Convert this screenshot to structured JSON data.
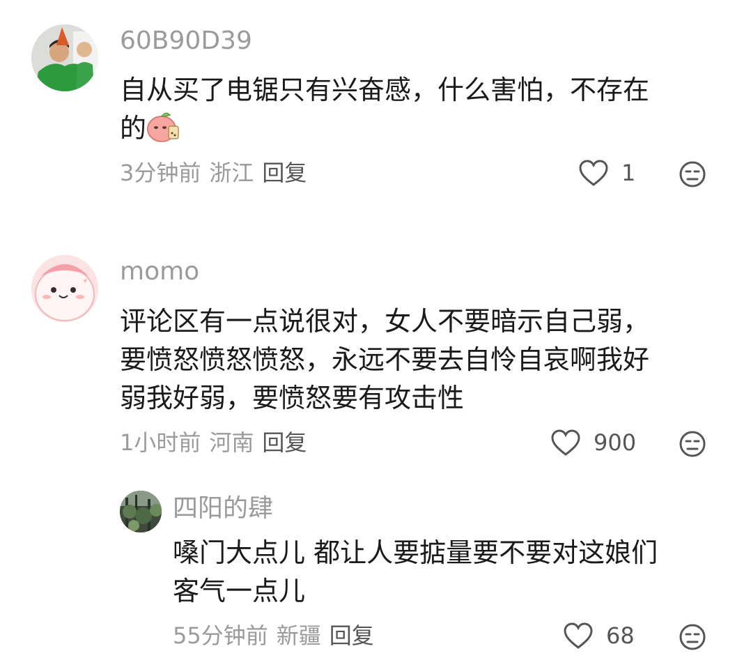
{
  "comments": [
    {
      "username": "60B90D39",
      "text_line1": "自从买了电锯只有兴奋感，什么害怕，不存在",
      "text_line2": "的",
      "sticker": "peach-sticker-icon",
      "time": "3分钟前",
      "location": "浙江",
      "reply_label": "回复",
      "likes": "1"
    },
    {
      "username": "momo",
      "text_line1": "评论区有一点说很对，女人不要暗示自己弱，",
      "text_line2": "要愤怒愤怒愤怒，永远不要去自怜自哀啊我好",
      "text_line3": "弱我好弱，要愤怒要有攻击性",
      "time": "1小时前",
      "location": "河南",
      "reply_label": "回复",
      "likes": "900"
    },
    {
      "username": "四阳的肆",
      "text_line1": "嗓门大点儿 都让人要掂量要不要对这娘们",
      "text_line2": "客气一点儿",
      "time": "55分钟前",
      "location": "新疆",
      "reply_label": "回复",
      "likes": "68"
    }
  ],
  "colors": {
    "meta": "#9a9a9a",
    "text": "#1a1a1a",
    "icon": "#555555"
  }
}
